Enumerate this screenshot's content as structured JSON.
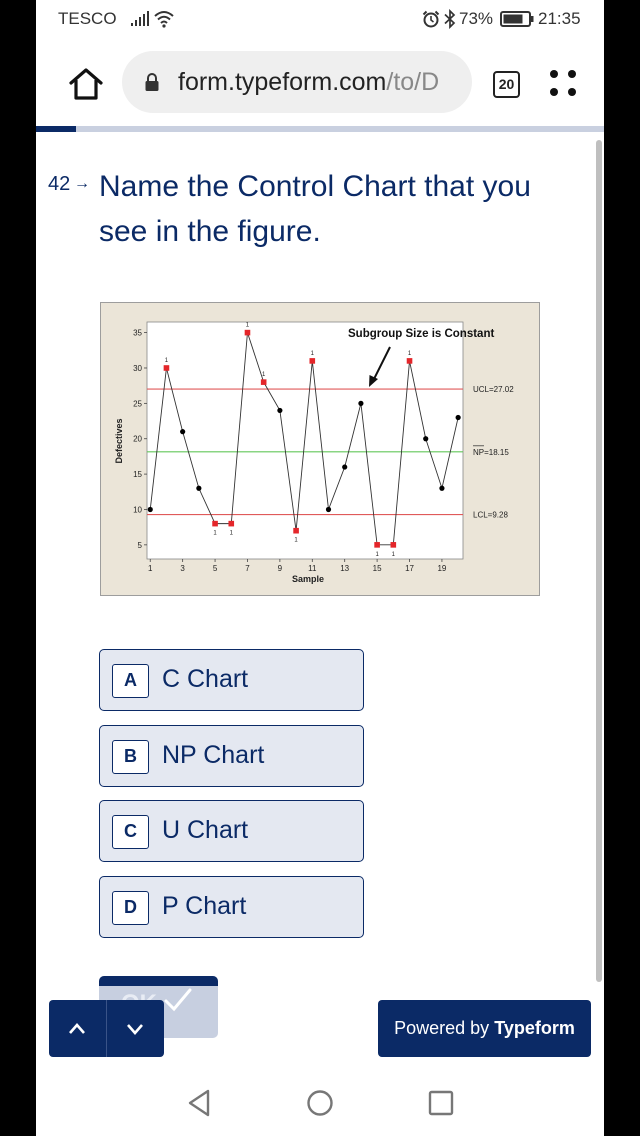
{
  "status_bar": {
    "carrier": "TESCO",
    "battery": "73%",
    "time": "21:35",
    "icons": [
      "signal-icon",
      "wifi-icon",
      "alarm-icon",
      "bluetooth-icon",
      "battery-icon"
    ]
  },
  "browser": {
    "url_main": "form.typeform.com",
    "url_rest": "/to/D",
    "tab_count": "20",
    "icons": [
      "home-icon",
      "lock-icon",
      "menu-icon"
    ]
  },
  "form_progress": 0.07,
  "question": {
    "number": "42",
    "arrow": "→",
    "title": "Name the Control Chart that you see in the figure."
  },
  "chart_data": {
    "type": "line",
    "title": "Subgroup Size is Constant",
    "xlabel": "Sample",
    "ylabel": "Defectives",
    "x": [
      1,
      2,
      3,
      4,
      5,
      6,
      7,
      8,
      9,
      10,
      11,
      12,
      13,
      14,
      15,
      16,
      17,
      18,
      19,
      20
    ],
    "series": [
      {
        "values": [
          10,
          30,
          21,
          13,
          8,
          8,
          35,
          28,
          24,
          7,
          31,
          10,
          16,
          25,
          5,
          5,
          31,
          20,
          13,
          23
        ]
      }
    ],
    "out_of_control": [
      2,
      5,
      6,
      7,
      8,
      10,
      11,
      15,
      16,
      17
    ],
    "point_labels": [
      "1",
      "1",
      "1",
      "1",
      "1",
      "1",
      "1",
      "1",
      "1",
      "1"
    ],
    "reference_lines": [
      {
        "label": "UCL=27.02",
        "value": 27.02,
        "color": "#e05a5a"
      },
      {
        "label": "NP=18.15",
        "value": 18.15,
        "color": "#63c75a"
      },
      {
        "label": "LCL=9.28",
        "value": 9.28,
        "color": "#e05a5a"
      }
    ],
    "xticks": [
      1,
      3,
      5,
      7,
      9,
      11,
      13,
      15,
      17,
      19
    ],
    "xtick_labels": [
      "1",
      "3",
      "5",
      "7",
      "9",
      "11",
      "13",
      "15",
      "17",
      "19"
    ],
    "yticks": [
      5,
      10,
      15,
      20,
      25,
      30,
      35
    ],
    "ytick_labels": [
      "5",
      "10",
      "15",
      "20",
      "25",
      "30",
      "35"
    ],
    "xlim": [
      0.8,
      20.3
    ],
    "ylim": [
      3,
      36.5
    ],
    "grid": false,
    "normal_color": "#000000",
    "flag_color": "#e4262a"
  },
  "choices": [
    {
      "key": "A",
      "label": "C Chart"
    },
    {
      "key": "B",
      "label": "NP Chart"
    },
    {
      "key": "C",
      "label": "U Chart"
    },
    {
      "key": "D",
      "label": "P Chart"
    }
  ],
  "ok_button": {
    "label": "OK"
  },
  "powered_by": {
    "prefix": "Powered by ",
    "brand": "Typeform"
  },
  "colors": {
    "brand": "#0b2a66",
    "choice_bg": "#e4e8f1",
    "progress_track": "#c9d0e0"
  }
}
